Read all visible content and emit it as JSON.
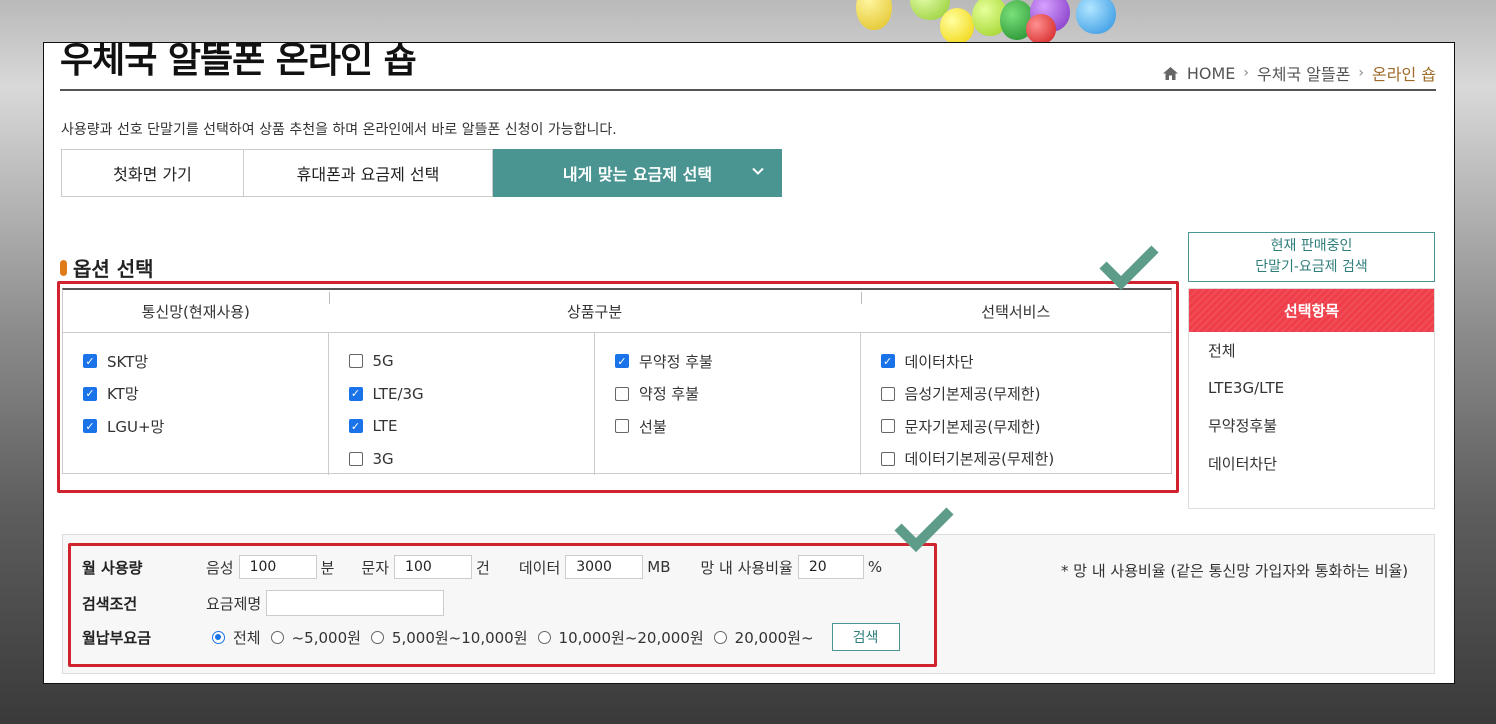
{
  "page": {
    "title": "우체국 알뜰폰 온라인 숍",
    "description": "사용량과 선호 단말기를 선택하여 상품 추천을 하며 온라인에서 바로 알뜰폰 신청이 가능합니다.",
    "breadcrumb": {
      "home": "HOME",
      "level1": "우체국 알뜰폰",
      "current": "온라인 숍"
    }
  },
  "tabs": [
    {
      "label": "첫화면 가기"
    },
    {
      "label": "휴대폰과 요금제 선택"
    },
    {
      "label": "내게 맞는 요금제 선택",
      "active": true
    }
  ],
  "options": {
    "title": "옵션 선택",
    "headers": {
      "network": "통신망(현재사용)",
      "product": "상품구분",
      "service": "선택서비스"
    },
    "network": [
      {
        "label": "SKT망",
        "checked": true
      },
      {
        "label": "KT망",
        "checked": true
      },
      {
        "label": "LGU+망",
        "checked": true
      }
    ],
    "product_type": [
      {
        "label": "5G",
        "checked": false
      },
      {
        "label": "LTE/3G",
        "checked": true
      },
      {
        "label": "LTE",
        "checked": true
      },
      {
        "label": "3G",
        "checked": false
      }
    ],
    "contract": [
      {
        "label": "무약정 후불",
        "checked": true
      },
      {
        "label": "약정 후불",
        "checked": false
      },
      {
        "label": "선불",
        "checked": false
      }
    ],
    "service": [
      {
        "label": "데이터차단",
        "checked": true
      },
      {
        "label": "음성기본제공(무제한)",
        "checked": false
      },
      {
        "label": "문자기본제공(무제한)",
        "checked": false
      },
      {
        "label": "데이터기본제공(무제한)",
        "checked": false
      }
    ]
  },
  "side": {
    "search_button_line1": "현재 판매중인",
    "search_button_line2": "단말기-요금제 검색",
    "panel_title": "선택항목",
    "items": [
      "전체",
      "LTE3G/LTE",
      "무약정후불",
      "데이터차단"
    ]
  },
  "search": {
    "monthly_usage_label": "월 사용량",
    "voice_label": "음성",
    "voice_value": "100",
    "voice_unit": "분",
    "sms_label": "문자",
    "sms_value": "100",
    "sms_unit": "건",
    "data_label": "데이터",
    "data_value": "3000",
    "data_unit": "MB",
    "ratio_label": "망 내 사용비율",
    "ratio_value": "20",
    "ratio_unit": "%",
    "condition_label": "검색조건",
    "plan_name_label": "요금제명",
    "plan_name_value": "",
    "fee_label": "월납부요금",
    "fee_options": [
      {
        "label": "전체",
        "selected": true
      },
      {
        "label": "~5,000원",
        "selected": false
      },
      {
        "label": "5,000원~10,000원",
        "selected": false
      },
      {
        "label": "10,000원~20,000원",
        "selected": false
      },
      {
        "label": "20,000원~",
        "selected": false
      }
    ],
    "search_button": "검색",
    "note": "* 망 내 사용비율 (같은 통신망 가입자와 통화하는 비율)"
  },
  "colors": {
    "accent": "#4a9592",
    "highlight": "#d0232e",
    "panel_head": "#ef3e4a",
    "check": "#1a73e8",
    "annotation_check": "#5e9c8a"
  }
}
